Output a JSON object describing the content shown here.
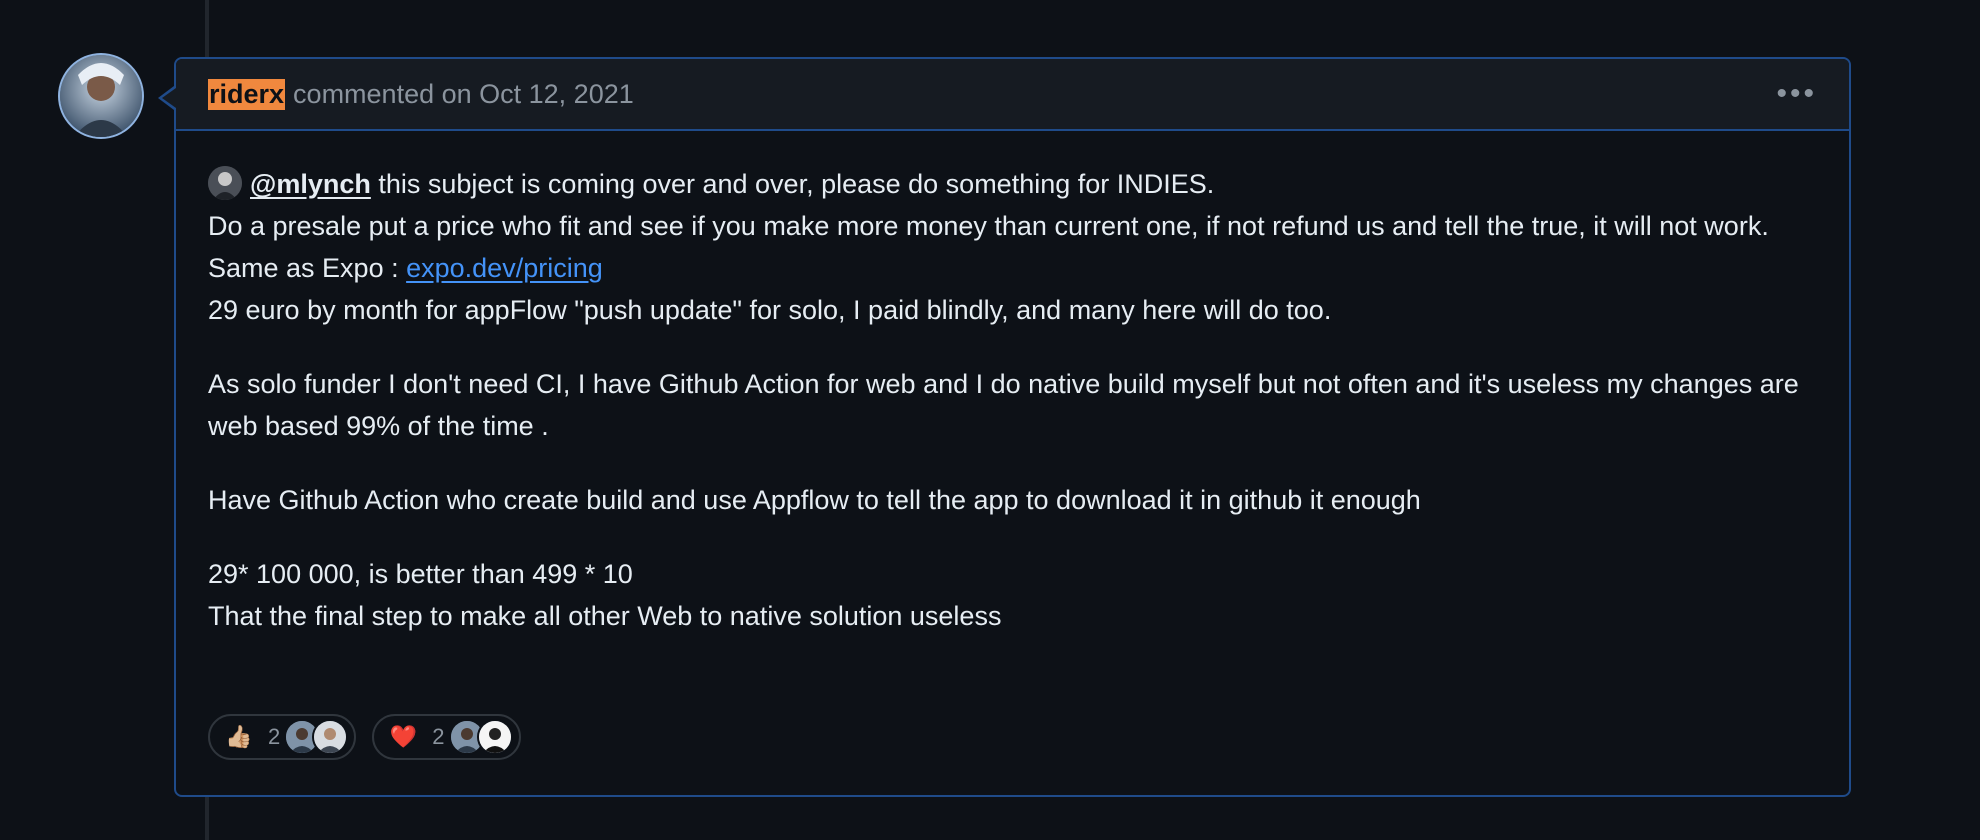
{
  "comment": {
    "author": "riderx",
    "meta": "commented on Oct 12, 2021",
    "more_label": "•••",
    "body": {
      "line1_mention": "@mlynch",
      "line1_rest": " this subject is coming over and over, please do something for INDIES.",
      "line2": "Do a presale put a price who fit and see if you make more money than current one, if not refund us and tell the true, it will not work.",
      "line3_prefix": "Same as Expo : ",
      "line3_link": "expo.dev/pricing",
      "line4": "29 euro by month for appFlow \"push update\" for solo, I paid blindly, and many here will do too.",
      "para2": "As solo funder I don't need CI, I have Github Action for web and I do native build myself but not often and it's useless my changes are web based 99% of the time .",
      "para3": "Have Github Action who create build and use Appflow to tell the app to download it in github it enough",
      "para4_line1": "29* 100 000, is better than 499 * 10",
      "para4_line2": "That the final step to make all other Web to native solution useless"
    },
    "reactions": [
      {
        "emoji": "👍🏼",
        "icon": "thumbs-up-icon",
        "count": "2"
      },
      {
        "emoji": "❤️",
        "icon": "heart-icon",
        "count": "2"
      }
    ]
  },
  "colors": {
    "background": "#0d1117",
    "header_bg": "#161b22",
    "border_accent": "#1f4b8a",
    "author_highlight": "#f0883e",
    "link": "#4493f8",
    "muted_text": "#8b949e"
  }
}
